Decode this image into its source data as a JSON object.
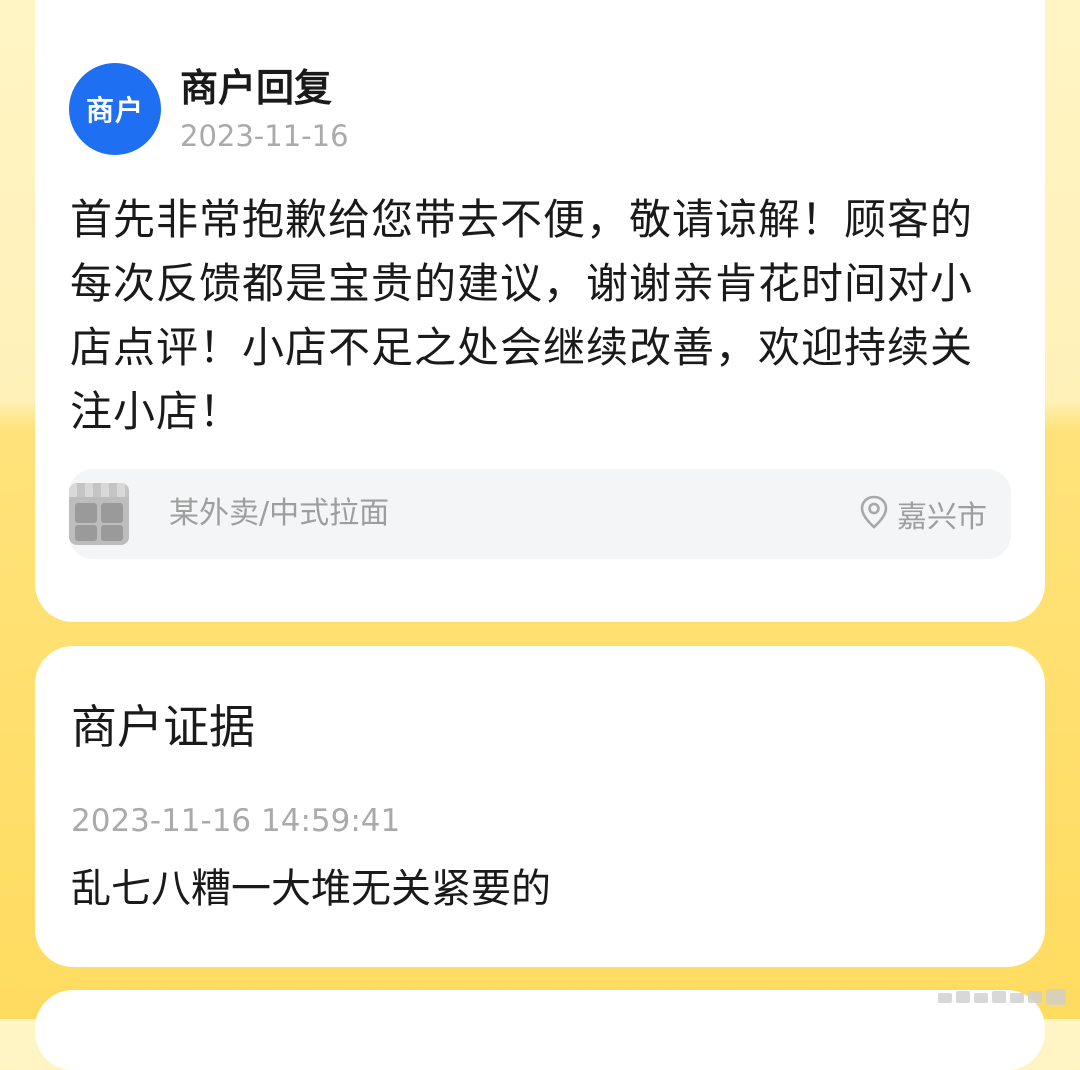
{
  "reply": {
    "avatar_label": "商户",
    "title": "商户回复",
    "date": "2023-11-16",
    "body": "首先非常抱歉给您带去不便，敬请谅解！顾客的每次反馈都是宝贵的建议，谢谢亲肯花时间对小店点评！小店不足之处会继续改善，欢迎持续关注小店！",
    "shop": {
      "thumbnail_icon": "storefront-icon",
      "name": "某外卖/中式拉面",
      "location_icon": "location-pin-icon",
      "location": "嘉兴市"
    }
  },
  "evidence": {
    "title": "商户证据",
    "timestamp": "2023-11-16 14:59:41",
    "content": "乱七八糟一大堆无关紧要的"
  },
  "colors": {
    "accent_blue": "#1E6FF2",
    "background_yellow": "#FFDC60",
    "card": "#FFFFFF",
    "muted_text": "#AAAAAA"
  }
}
